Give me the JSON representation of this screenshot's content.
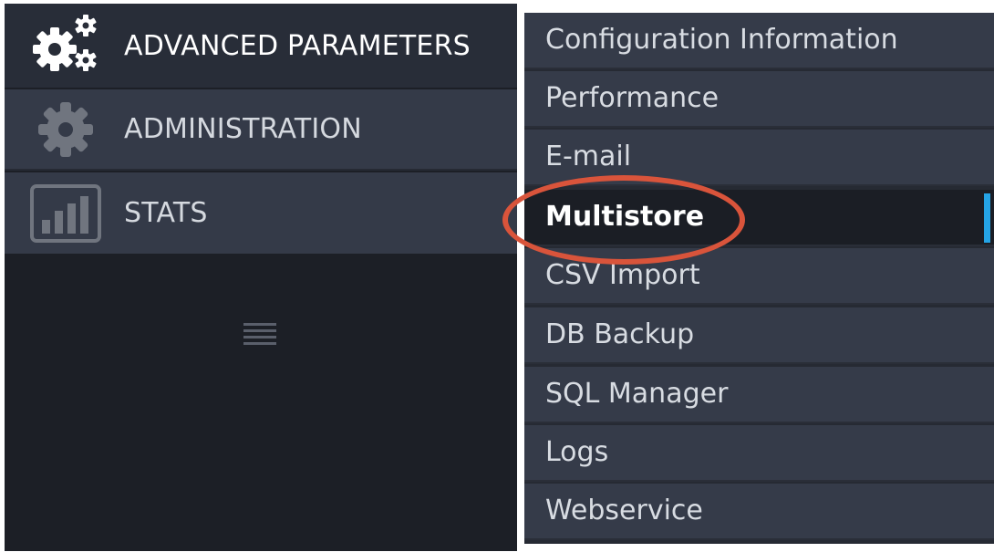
{
  "sidebar": {
    "items": [
      {
        "label": "ADVANCED PARAMETERS",
        "icon": "gears-icon"
      },
      {
        "label": "ADMINISTRATION",
        "icon": "gear-icon"
      },
      {
        "label": "STATS",
        "icon": "bar-chart-icon"
      }
    ],
    "collapse_icon": "menu-lines-icon"
  },
  "submenu": {
    "items": [
      {
        "label": "Configuration Information"
      },
      {
        "label": "Performance"
      },
      {
        "label": "E-mail"
      },
      {
        "label": "Multistore",
        "active": true
      },
      {
        "label": "CSV Import"
      },
      {
        "label": "DB Backup"
      },
      {
        "label": "SQL Manager"
      },
      {
        "label": "Logs"
      },
      {
        "label": "Webservice"
      }
    ],
    "active_color": "#25a4e6",
    "highlight_color": "#d9543b"
  }
}
